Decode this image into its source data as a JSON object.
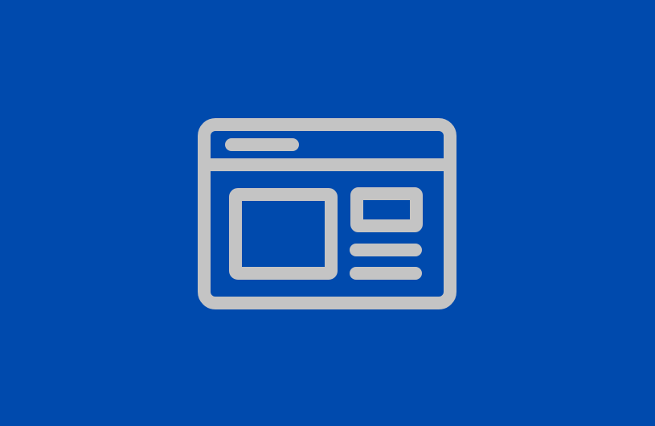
{
  "colors": {
    "background": "#004AAD",
    "icon_stroke": "#C4C4C4"
  },
  "icon": {
    "name": "browser-window-layout-icon"
  }
}
